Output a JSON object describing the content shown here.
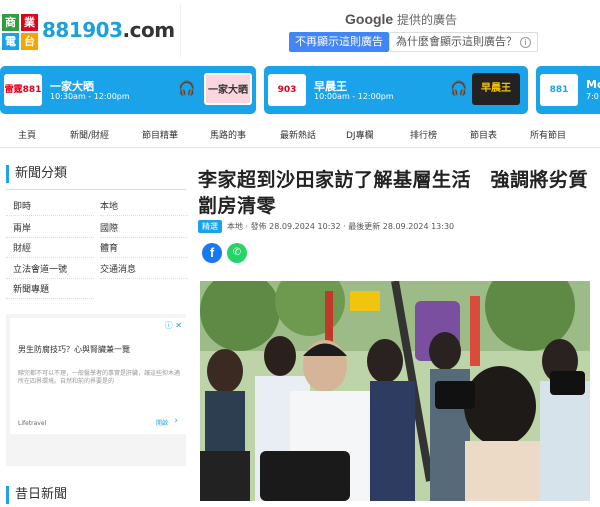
{
  "header": {
    "logo_line1": "商業",
    "logo_line2": "電台",
    "site_name": "881903",
    "site_suffix": ".com",
    "ad_title_prefix": "Google",
    "ad_title": " 提供的廣告",
    "ad_stop_button": "不再顯示這則廣告",
    "ad_why_button": "為什麼會顯示這則廣告？",
    "ad_info_icon": "i"
  },
  "programs": [
    {
      "badge": "雷霆881",
      "name": "一家大晒",
      "time": "10:30am - 12:00pm",
      "thumb": "一家大晒"
    },
    {
      "badge": "903",
      "name": "早晨王",
      "time": "10:00am - 12:00pm",
      "thumb": "早晨王"
    },
    {
      "badge": "881",
      "name": "Mo",
      "time": "7:0"
    }
  ],
  "nav": {
    "items": [
      "主頁",
      "新聞/財經",
      "節目精華",
      "馬路的事",
      "最新熱話",
      "DJ專欄",
      "排行榜",
      "節目表",
      "所有節目"
    ]
  },
  "sidebar": {
    "heading": "新聞分類",
    "categories": [
      "即時",
      "本地",
      "兩岸",
      "國際",
      "財經",
      "體育",
      "立法會道一號",
      "交通消息",
      "新聞專題"
    ],
    "heading2": "昔日新聞",
    "ad": {
      "close": "ⓘ ✕",
      "title": "男生防腐技巧？心與腎臟兼一覽",
      "desc": "睇完都不可以不理，一般醫學者的事實是肝臟，讓這些抑木適所在四界環境。自然和前的界要是的",
      "source": "Lifetravel",
      "open": "開啟",
      "arrow": "›"
    }
  },
  "article": {
    "title": "李家超到沙田家訪了解基層生活　強調將劣質劏房清零",
    "tag": "精選",
    "meta": "本地 · 發佈 28.09.2024 10:32 · 最後更新 28.09.2024 13:30",
    "share_fb": "f",
    "share_wa": "✆"
  },
  "colors": {
    "brand_blue": "#1aa3e8",
    "logo_green": "#2e9e3f",
    "logo_red": "#e2001a",
    "facebook": "#1877f2",
    "whatsapp": "#25d366"
  }
}
